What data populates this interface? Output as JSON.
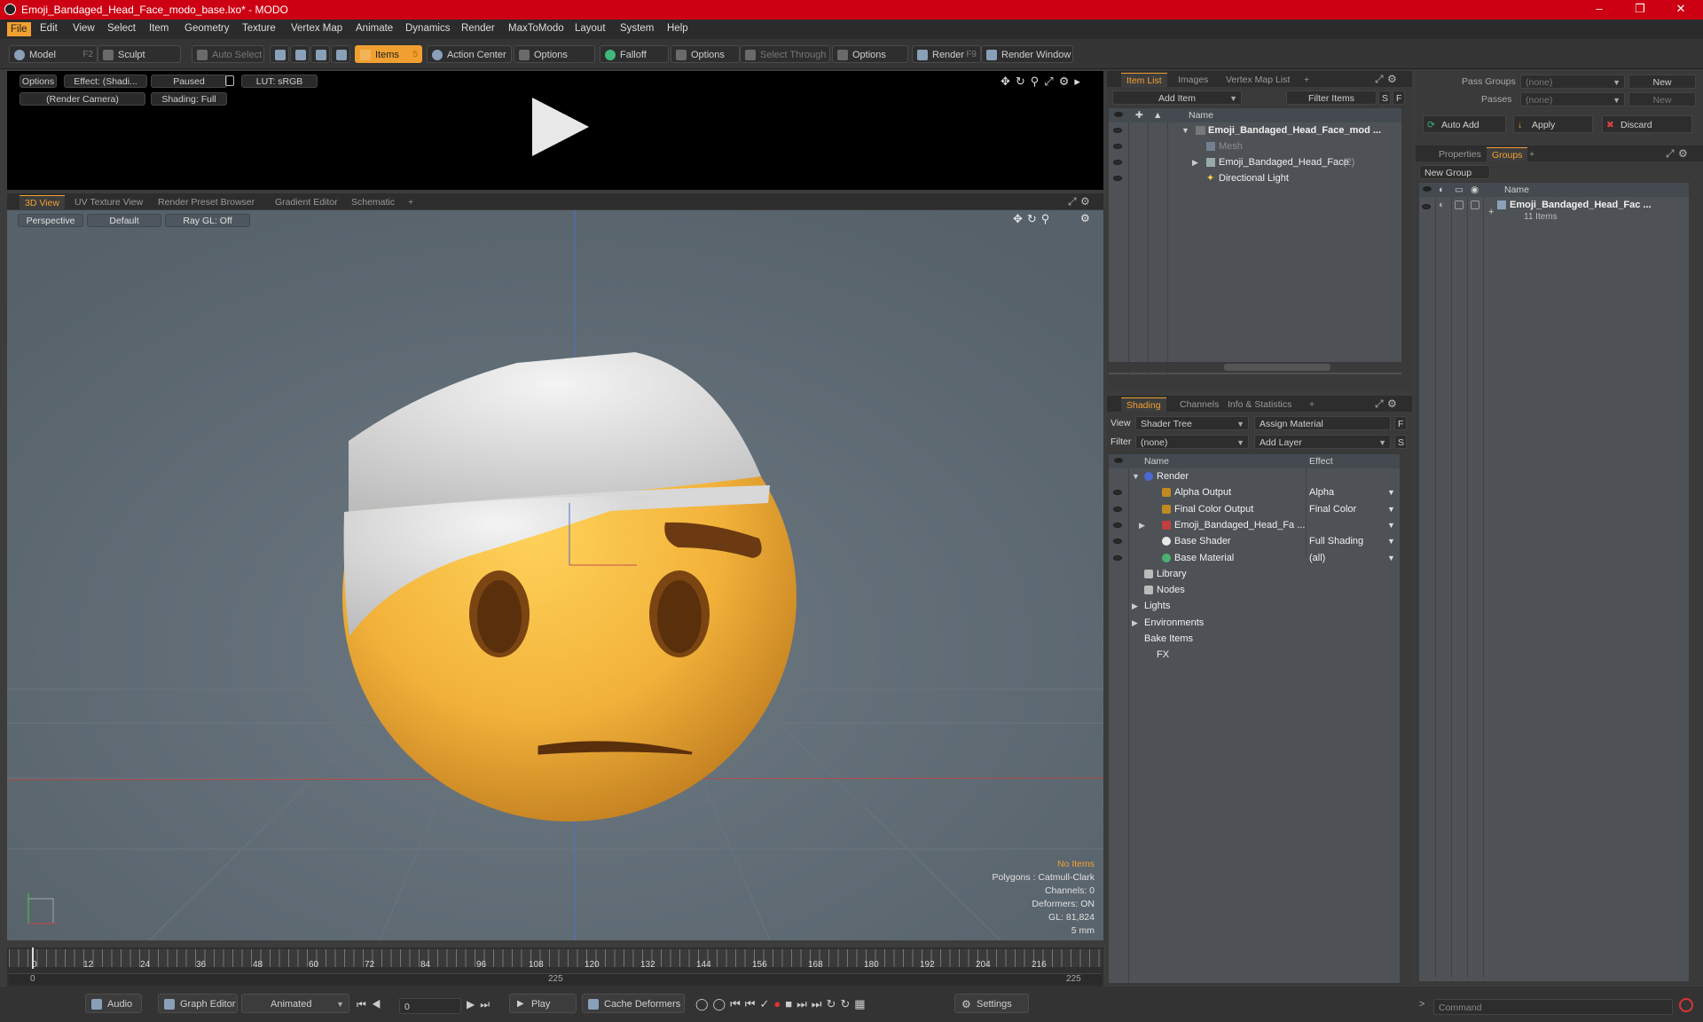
{
  "window": {
    "title": "Emoji_Bandaged_Head_Face_modo_base.lxo* - MODO"
  },
  "menu": [
    "File",
    "Edit",
    "View",
    "Select",
    "Item",
    "Geometry",
    "Texture",
    "Vertex Map",
    "Animate",
    "Dynamics",
    "Render",
    "MaxToModo",
    "Layout",
    "System",
    "Help"
  ],
  "toolbar": {
    "model": "Model",
    "model_key": "F2",
    "sculpt": "Sculpt",
    "auto_select": "Auto Select",
    "items": "Items",
    "items_key": "5",
    "action_center": "Action Center",
    "options1": "Options",
    "falloff": "Falloff",
    "options2": "Options",
    "select_through": "Select Through",
    "options3": "Options",
    "render": "Render",
    "render_key": "F9",
    "render_window": "Render Window"
  },
  "render_preview": {
    "options": "Options",
    "effect": "Effect: (Shadi...",
    "paused": "Paused",
    "lut": "LUT: sRGB",
    "camera": "(Render Camera)",
    "shading": "Shading: Full"
  },
  "viewport_tabs": [
    "3D View",
    "UV Texture View",
    "Render Preset Browser",
    "Gradient Editor",
    "Schematic",
    "+"
  ],
  "viewport": {
    "perspective": "Perspective",
    "default": "Default",
    "raygl": "Ray GL: Off",
    "stats": {
      "no_items": "No Items",
      "polygons": "Polygons : Catmull-Clark",
      "channels": "Channels: 0",
      "deformers": "Deformers: ON",
      "gl": "GL: 81,824",
      "units": "5 mm"
    }
  },
  "timeline": {
    "ticks": [
      "0",
      "12",
      "24",
      "36",
      "48",
      "60",
      "72",
      "84",
      "96",
      "108",
      "120",
      "132",
      "144",
      "156",
      "168",
      "180",
      "192",
      "204",
      "216"
    ],
    "range_start": "0",
    "range_mid": "225",
    "range_end": "225"
  },
  "bottombar": {
    "audio": "Audio",
    "graph_editor": "Graph Editor",
    "animated": "Animated",
    "frame": "0",
    "play": "Play",
    "cache": "Cache Deformers",
    "settings": "Settings",
    "command": "Command"
  },
  "item_list": {
    "tabs": [
      "Item List",
      "Images",
      "Vertex Map List",
      "+"
    ],
    "add_item": "Add Item",
    "filter_items": "Filter Items",
    "s": "S",
    "f": "F",
    "col_name": "Name",
    "rows": [
      {
        "label": "Emoji_Bandaged_Head_Face_mod ...",
        "bold": true,
        "indent": 0
      },
      {
        "label": "Mesh",
        "dim": true,
        "indent": 1
      },
      {
        "label": "Emoji_Bandaged_Head_Face",
        "count": "(2)",
        "indent": 1
      },
      {
        "label": "Directional Light",
        "indent": 1
      }
    ]
  },
  "shading": {
    "tabs": [
      "Shading",
      "Channels",
      "Info & Statistics",
      "+"
    ],
    "view_label": "View",
    "view_value": "Shader Tree",
    "assign_material": "Assign Material",
    "f": "F",
    "filter_label": "Filter",
    "filter_value": "(none)",
    "add_layer": "Add Layer",
    "s": "S",
    "col_name": "Name",
    "col_effect": "Effect",
    "rows": [
      {
        "label": "Render",
        "effect": "",
        "indent": 0,
        "eye": false
      },
      {
        "label": "Alpha Output",
        "effect": "Alpha",
        "indent": 1,
        "eye": true
      },
      {
        "label": "Final Color Output",
        "effect": "Final Color",
        "indent": 1,
        "eye": true
      },
      {
        "label": "Emoji_Bandaged_Head_Fa ...",
        "effect": "",
        "indent": 1,
        "eye": true
      },
      {
        "label": "Base Shader",
        "effect": "Full Shading",
        "indent": 1,
        "eye": true
      },
      {
        "label": "Base Material",
        "effect": "(all)",
        "indent": 1,
        "eye": true
      },
      {
        "label": "Library",
        "effect": "",
        "indent": 0,
        "eye": false
      },
      {
        "label": "Nodes",
        "effect": "",
        "indent": 0,
        "eye": false
      },
      {
        "label": "Lights",
        "effect": "",
        "indent": -1,
        "eye": false
      },
      {
        "label": "Environments",
        "effect": "",
        "indent": -1,
        "eye": false
      },
      {
        "label": "Bake Items",
        "effect": "",
        "indent": -1,
        "eye": false
      },
      {
        "label": "FX",
        "effect": "",
        "indent": 0,
        "eye": false
      }
    ]
  },
  "groups": {
    "pass_groups": "Pass Groups",
    "pass_groups_value": "(none)",
    "new": "New",
    "passes": "Passes",
    "passes_value": "(none)",
    "new2": "New",
    "auto_add": "Auto Add",
    "apply": "Apply",
    "discard": "Discard",
    "tabs": [
      "Properties",
      "Groups",
      "+"
    ],
    "new_group": "New Group",
    "col_name": "Name",
    "group_name": "Emoji_Bandaged_Head_Fac ...",
    "group_items": "11 Items"
  }
}
